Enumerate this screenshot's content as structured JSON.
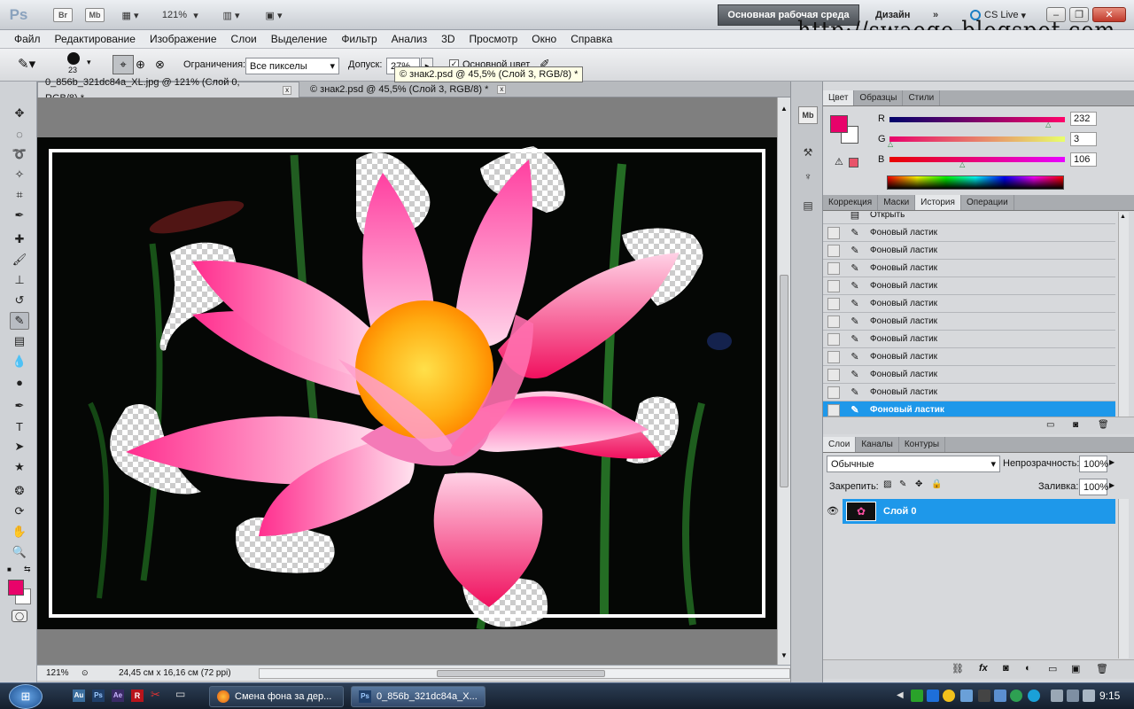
{
  "app": {
    "logo": "Ps",
    "bridge": "Br",
    "minibridge": "Mb",
    "zoom": "121%",
    "workspace_active": "Основная рабочая среда",
    "workspace_design": "Дизайн",
    "more": "»",
    "cslive": "CS Live",
    "watermark": "http://swaego.blogspot.com"
  },
  "menu": [
    "Файл",
    "Редактирование",
    "Изображение",
    "Слои",
    "Выделение",
    "Фильтр",
    "Анализ",
    "3D",
    "Просмотр",
    "Окно",
    "Справка"
  ],
  "options": {
    "brush_size": "23",
    "limits_label": "Ограничения:",
    "limits_value": "Все пикселы",
    "tolerance_label": "Допуск:",
    "tolerance_value": "27%",
    "protect_label": "Основной цвет",
    "tooltip": "© знак2.psd @ 45,5% (Слой 3, RGB/8) *"
  },
  "tabs": [
    {
      "label": "0_856b_321dc84a_XL.jpg @ 121% (Слой 0, RGB/8) *",
      "close": "x"
    },
    {
      "label": "© знак2.psd @ 45,5% (Слой 3, RGB/8) *",
      "close": "x"
    }
  ],
  "status": {
    "zoom": "121%",
    "info": "24,45 см x 16,16 см (72 ppi)"
  },
  "color_panel": {
    "tabs": [
      "Цвет",
      "Образцы",
      "Стили"
    ],
    "r_label": "R",
    "g_label": "G",
    "b_label": "B",
    "r": "232",
    "g": "3",
    "b": "106",
    "r_level": 0.91,
    "g_level": 0.01,
    "b_level": 0.42,
    "foreground": "#e8036a"
  },
  "history_panel": {
    "tabs": [
      "Коррекция",
      "Маски",
      "История",
      "Операции"
    ],
    "open_label": "Открыть",
    "items": [
      "Фоновый ластик",
      "Фоновый ластик",
      "Фоновый ластик",
      "Фоновый ластик",
      "Фоновый ластик",
      "Фоновый ластик",
      "Фоновый ластик",
      "Фоновый ластик",
      "Фоновый ластик",
      "Фоновый ластик",
      "Фоновый ластик"
    ]
  },
  "layers_panel": {
    "tabs": [
      "Слои",
      "Каналы",
      "Контуры"
    ],
    "blend_mode": "Обычные",
    "opacity_label": "Непрозрачность:",
    "opacity": "100%",
    "lock_label": "Закрепить:",
    "fill_label": "Заливка:",
    "fill": "100%",
    "layer_name": "Слой 0"
  },
  "taskbar": {
    "task1": "Смена фона за дер...",
    "task2": "0_856b_321dc84a_X...",
    "clock": "9:15"
  }
}
